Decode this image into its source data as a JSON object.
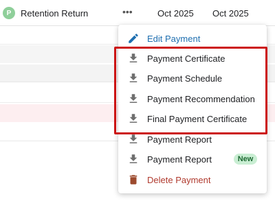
{
  "row": {
    "avatar_letter": "P",
    "title": "Retention Return",
    "more_glyph": "•••",
    "date1": "Oct 2025",
    "date2": "Oct 2025"
  },
  "menu": {
    "items": [
      {
        "label": "Edit Payment",
        "icon": "pencil-icon"
      },
      {
        "label": "Payment Certificate",
        "icon": "download-icon"
      },
      {
        "label": "Payment Schedule",
        "icon": "download-icon"
      },
      {
        "label": "Payment Recommendation",
        "icon": "download-icon"
      },
      {
        "label": "Final Payment Certificate",
        "icon": "download-icon"
      },
      {
        "label": "Payment Report",
        "icon": "download-icon"
      },
      {
        "label": "Payment Report",
        "icon": "download-icon",
        "badge": "New"
      },
      {
        "label": "Delete Payment",
        "icon": "trash-icon"
      }
    ]
  },
  "colors": {
    "edit": "#1f6fb0",
    "delete": "#b03a2e",
    "highlight_border": "#cc1414",
    "badge_bg": "#c9eed3",
    "avatar_bg": "#8fcf9a"
  }
}
